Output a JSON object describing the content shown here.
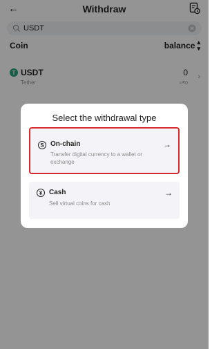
{
  "header": {
    "title": "Withdraw",
    "back_icon": "arrow-left-icon",
    "record_icon": "document-clock-icon"
  },
  "search": {
    "value": "USDT",
    "placeholder": "",
    "search_icon": "search-icon",
    "clear_icon": "clear-icon"
  },
  "columns": {
    "left": "Coin",
    "right": "balance"
  },
  "coins": [
    {
      "symbol": "USDT",
      "name": "Tether",
      "balance": "0",
      "fiat": "≈₹0",
      "logo_letter": "T"
    }
  ],
  "modal": {
    "title": "Select the withdrawal type",
    "options": [
      {
        "title": "On-chain",
        "description": "Transfer digital currency to a wallet or exchange",
        "icon": "S",
        "selected": true
      },
      {
        "title": "Cash",
        "description": "Sell virtual coins for cash",
        "icon": "¥",
        "selected": false
      }
    ]
  },
  "colors": {
    "highlight": "#d72a2a",
    "tether_green": "#26a17b",
    "overlay": "rgba(0,0,0,0.42)"
  }
}
